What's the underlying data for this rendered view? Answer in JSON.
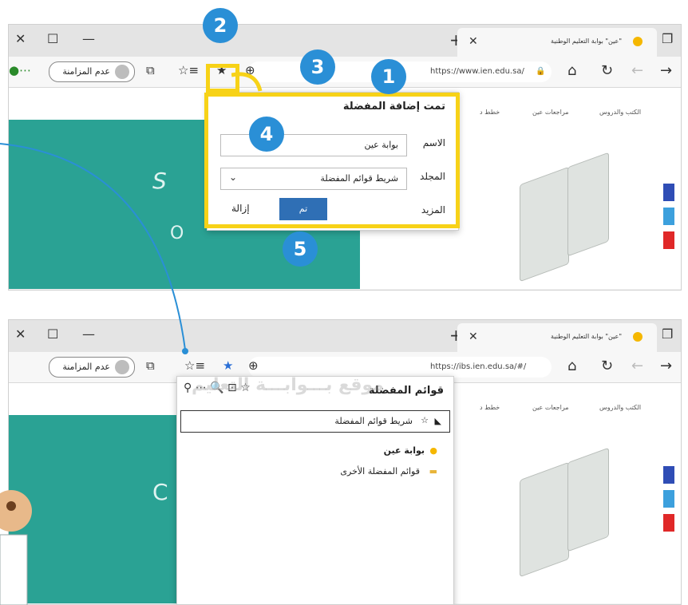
{
  "browser": {
    "tab_title": "\"عين\" بوابة التعليم الوطنية",
    "url_top": "https://www.ien.edu.sa/",
    "url_bottom": "https://ibs.ien.edu.sa/#/",
    "profile_label": "عدم المزامنة"
  },
  "page_nav": {
    "books": "الكتب والدروس",
    "reviews": "مراجعات عين",
    "plans": "خطط د"
  },
  "add_favorite_dialog": {
    "title": "تمت إضافة المفضلة",
    "name_label": "الاسم",
    "name_value": "بوابة عين",
    "folder_label": "المجلد",
    "folder_value": "شريط قوائم المفضلة",
    "more_label": "المزيد",
    "done_label": "تم",
    "remove_label": "إزالة"
  },
  "favorites_panel": {
    "title": "قوائم المفضلة",
    "folder_bar": "شريط قوائم المفضلة",
    "item_portal": "بوابة عين",
    "other_folder": "قوائم المفضلة الأخرى"
  },
  "badges": [
    "1",
    "2",
    "3",
    "4",
    "5"
  ],
  "watermark": "موقع بـــوابـــة التعليم",
  "colors": {
    "highlight": "#f7d217",
    "badge": "#2a8fd6",
    "teal": "#2aa294",
    "done_button": "#2f6fb5"
  }
}
